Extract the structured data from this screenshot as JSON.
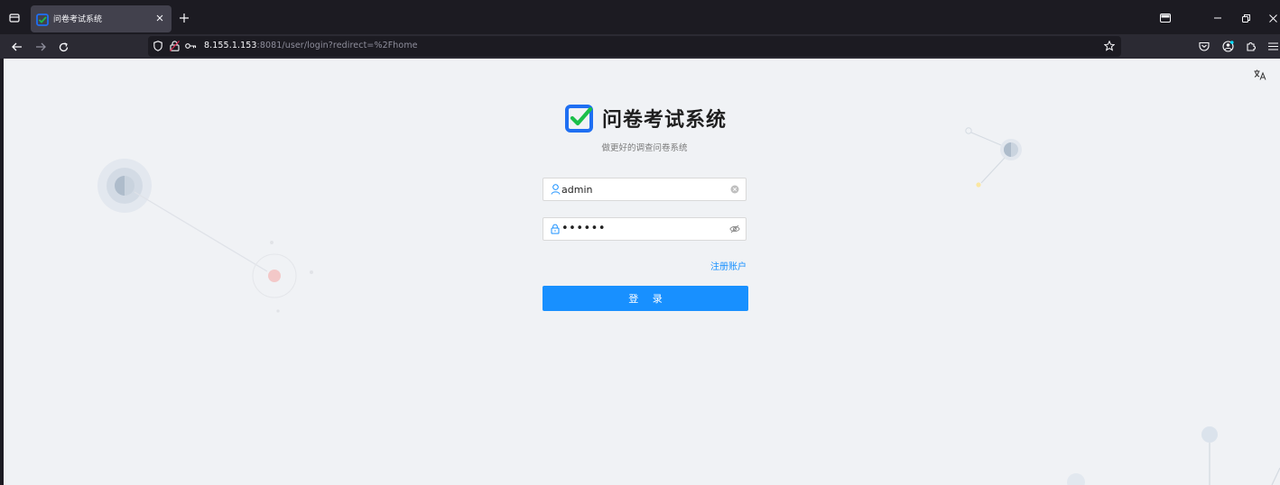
{
  "browser": {
    "tab": {
      "title": "问卷考试系统"
    },
    "url": {
      "host": "8.155.1.153",
      "rest": ":8081/user/login?redirect=%2Fhome"
    }
  },
  "app": {
    "title": "问卷考试系统",
    "subtitle": "做更好的调查问卷系统"
  },
  "login_form": {
    "username": {
      "value": "admin"
    },
    "password": {
      "value": "••••••"
    },
    "register_label": "注册账户",
    "submit_label": "登 录"
  },
  "colors": {
    "primary": "#1890ff",
    "page_bg": "#f0f2f5",
    "logo_blue": "#1f6ff2",
    "logo_check": "#1bbf4a"
  }
}
